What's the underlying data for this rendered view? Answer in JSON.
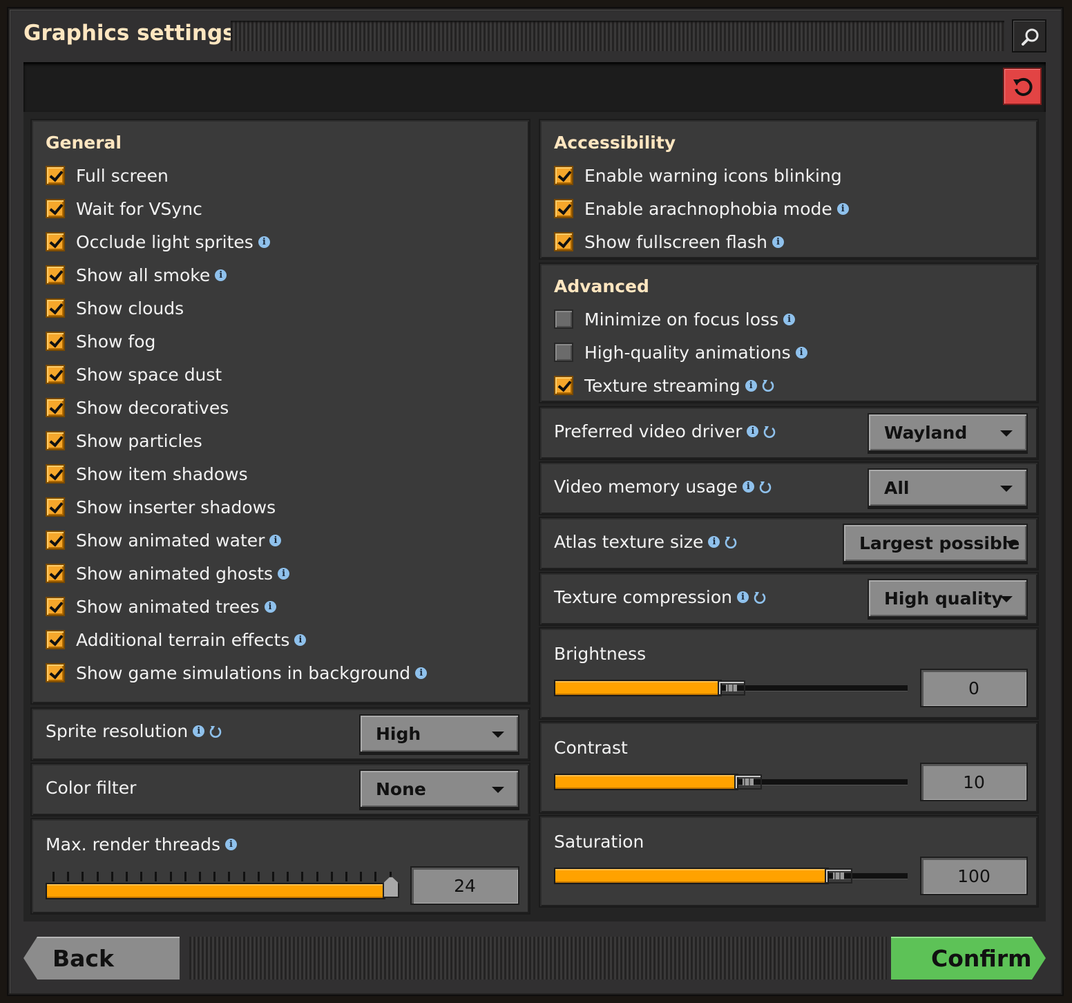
{
  "window": {
    "title": "Graphics settings"
  },
  "colors": {
    "accent_orange": "#ffa200",
    "heading": "#ffe6c0",
    "info_blue": "#8fc1ec",
    "reset_red": "#e24444",
    "confirm_green": "#5dc257"
  },
  "general": {
    "heading": "General",
    "items": [
      {
        "label": "Full screen",
        "checked": true
      },
      {
        "label": "Wait for VSync",
        "checked": true
      },
      {
        "label": "Occlude light sprites",
        "checked": true
      },
      {
        "label": "Show all smoke",
        "checked": true
      },
      {
        "label": "Show clouds",
        "checked": true
      },
      {
        "label": "Show fog",
        "checked": true
      },
      {
        "label": "Show space dust",
        "checked": true
      },
      {
        "label": "Show decoratives",
        "checked": true
      },
      {
        "label": "Show particles",
        "checked": true
      },
      {
        "label": "Show item shadows",
        "checked": true
      },
      {
        "label": "Show inserter shadows",
        "checked": true
      },
      {
        "label": "Show animated water",
        "checked": true
      },
      {
        "label": "Show animated ghosts",
        "checked": true
      },
      {
        "label": "Show animated trees",
        "checked": true
      },
      {
        "label": "Additional terrain effects",
        "checked": true
      },
      {
        "label": "Show game simulations in background",
        "checked": true
      }
    ]
  },
  "sprite_resolution": {
    "label": "Sprite resolution",
    "value": "High"
  },
  "color_filter": {
    "label": "Color filter",
    "value": "None"
  },
  "render_threads": {
    "label": "Max. render threads",
    "value": "24",
    "level": 1.0
  },
  "accessibility": {
    "heading": "Accessibility",
    "items": [
      {
        "label": "Enable warning icons blinking",
        "checked": true
      },
      {
        "label": "Enable arachnophobia mode",
        "checked": true
      },
      {
        "label": "Show fullscreen flash",
        "checked": true
      }
    ]
  },
  "advanced": {
    "heading": "Advanced",
    "items": [
      {
        "label": "Minimize on focus loss",
        "checked": false
      },
      {
        "label": "High-quality animations",
        "checked": false
      },
      {
        "label": "Texture streaming",
        "checked": true
      }
    ]
  },
  "video_driver": {
    "label": "Preferred video driver",
    "value": "Wayland"
  },
  "video_memory": {
    "label": "Video memory usage",
    "value": "All"
  },
  "atlas_size": {
    "label": "Atlas texture size",
    "value": "Largest possible"
  },
  "texture_compression": {
    "label": "Texture compression",
    "value": "High quality"
  },
  "brightness": {
    "label": "Brightness",
    "value": "0",
    "level": 0.5
  },
  "contrast": {
    "label": "Contrast",
    "value": "10",
    "level": 0.55
  },
  "saturation": {
    "label": "Saturation",
    "value": "100",
    "level": 0.83
  },
  "footer": {
    "back_label": "Back",
    "confirm_label": "Confirm"
  }
}
